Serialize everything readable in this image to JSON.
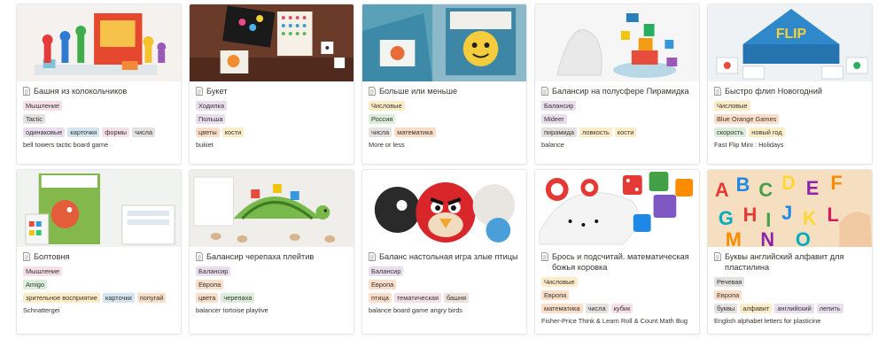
{
  "cards": [
    {
      "title": "Башня из колокольчиков",
      "cover_icon": "bell-tower-game-photo",
      "rows": [
        [
          {
            "text": "Мышление",
            "color": "t-pink"
          }
        ],
        [
          {
            "text": "Tactic",
            "color": "t-gray"
          }
        ],
        [
          {
            "text": "одинаковые",
            "color": "t-purple"
          },
          {
            "text": "карточки",
            "color": "t-blue"
          },
          {
            "text": "формы",
            "color": "t-pink"
          },
          {
            "text": "числа",
            "color": "t-gray"
          }
        ]
      ],
      "desc": "bell towers tactic board game"
    },
    {
      "title": "Букет",
      "cover_icon": "bouquet-game-photo",
      "rows": [
        [
          {
            "text": "Ходилка",
            "color": "t-purple"
          }
        ],
        [
          {
            "text": "Польша",
            "color": "t-purple"
          }
        ],
        [
          {
            "text": "цветы",
            "color": "t-orange"
          },
          {
            "text": "кости",
            "color": "t-yellow"
          }
        ]
      ],
      "desc": "bukiet"
    },
    {
      "title": "Больше или меньше",
      "cover_icon": "more-or-less-game-photo",
      "rows": [
        [
          {
            "text": "Числовые",
            "color": "t-yellow"
          }
        ],
        [
          {
            "text": "Россия",
            "color": "t-green"
          }
        ],
        [
          {
            "text": "числа",
            "color": "t-gray"
          },
          {
            "text": "математика",
            "color": "t-orange"
          }
        ]
      ],
      "desc": "More or less"
    },
    {
      "title": "Балансир на полусфере Пирамидка",
      "cover_icon": "balance-pyramid-photo",
      "rows": [
        [
          {
            "text": "Балансир",
            "color": "t-purple"
          }
        ],
        [
          {
            "text": "Mideer",
            "color": "t-purple"
          }
        ],
        [
          {
            "text": "пирамида",
            "color": "t-gray"
          },
          {
            "text": "ловкость",
            "color": "t-yellow"
          },
          {
            "text": "кости",
            "color": "t-yellow"
          }
        ]
      ],
      "desc": "balance"
    },
    {
      "title": "Быстро флип Новогодний",
      "cover_icon": "fast-flip-game-photo",
      "rows": [
        [
          {
            "text": "Числовые",
            "color": "t-yellow"
          }
        ],
        [
          {
            "text": "Blue Orange Games",
            "color": "t-orange"
          }
        ],
        [
          {
            "text": "скорость",
            "color": "t-green"
          },
          {
            "text": "новый год",
            "color": "t-yellow"
          }
        ]
      ],
      "desc": "Fast Flip Mini : Holidays"
    },
    {
      "title": "Болтовня",
      "cover_icon": "boltovnya-game-photo",
      "rows": [
        [
          {
            "text": "Мышление",
            "color": "t-pink"
          }
        ],
        [
          {
            "text": "Amigo",
            "color": "t-green"
          }
        ],
        [
          {
            "text": "зрительное восприятие",
            "color": "t-yellow"
          },
          {
            "text": "карточки",
            "color": "t-blue"
          },
          {
            "text": "попугай",
            "color": "t-orange"
          }
        ]
      ],
      "desc": "Schnattergei"
    },
    {
      "title": "Балансир черепаха плейтив",
      "cover_icon": "tortoise-balance-photo",
      "rows": [
        [
          {
            "text": "Балансир",
            "color": "t-purple"
          }
        ],
        [
          {
            "text": "Европа",
            "color": "t-orange"
          }
        ],
        [
          {
            "text": "цвета",
            "color": "t-orange"
          },
          {
            "text": "черепаха",
            "color": "t-green"
          }
        ]
      ],
      "desc": "balancer tortoise playtive"
    },
    {
      "title": "Баланс настольная игра злые птицы",
      "cover_icon": "angry-birds-photo",
      "rows": [
        [
          {
            "text": "Балансир",
            "color": "t-purple"
          }
        ],
        [
          {
            "text": "Европа",
            "color": "t-orange"
          }
        ],
        [
          {
            "text": "птица",
            "color": "t-orange"
          },
          {
            "text": "тематическая",
            "color": "t-pink"
          },
          {
            "text": "башня",
            "color": "t-brown"
          }
        ]
      ],
      "desc": "balance board game angry birds"
    },
    {
      "title": "Брось и подсчитай. математическая божья коровка",
      "cover_icon": "math-bug-photo",
      "rows": [
        [
          {
            "text": "Числовые",
            "color": "t-yellow"
          }
        ],
        [
          {
            "text": "Европа",
            "color": "t-orange"
          }
        ],
        [
          {
            "text": "математика",
            "color": "t-orange"
          },
          {
            "text": "числа",
            "color": "t-gray"
          },
          {
            "text": "кубик",
            "color": "t-pink"
          }
        ]
      ],
      "desc": "Fisher-Price Think & Learn Roll & Count Math Bug"
    },
    {
      "title": "Буквы английский алфавит для пластилина",
      "cover_icon": "alphabet-letters-photo",
      "rows": [
        [
          {
            "text": "Речевая",
            "color": "t-gray"
          }
        ],
        [
          {
            "text": "Европа",
            "color": "t-orange"
          }
        ],
        [
          {
            "text": "буквы",
            "color": "t-gray"
          },
          {
            "text": "алфавит",
            "color": "t-yellow"
          },
          {
            "text": "английский",
            "color": "t-purple"
          },
          {
            "text": "лепить",
            "color": "t-purple"
          }
        ]
      ],
      "desc": "English alphabet letters for plasticine"
    }
  ]
}
